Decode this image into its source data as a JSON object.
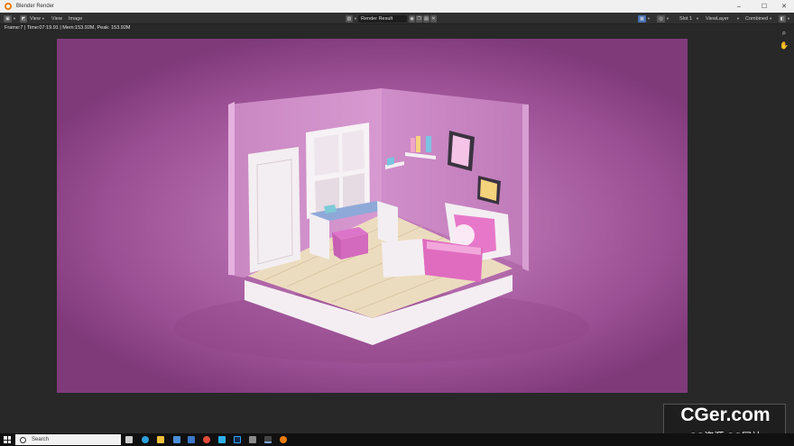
{
  "window": {
    "title": "Blender Render",
    "minimize": "–",
    "maximize": "☐",
    "close": "✕"
  },
  "header": {
    "menus": [
      "View",
      "View",
      "Image"
    ],
    "image_name": "Render Result",
    "slot": "Slot 1",
    "view_layer": "ViewLayer",
    "pass": "Combined"
  },
  "status": {
    "text": "Frame:7 | Time:07:19.91 | Mem:153.92M, Peak: 153.92M"
  },
  "taskbar": {
    "search_placeholder": "Search"
  },
  "watermark": {
    "brand": "CGer.com",
    "sub": "CG资源 CG网站"
  },
  "colors": {
    "accent": "#e87d0d",
    "render_bg": "#b26aab",
    "header_bg": "#303030"
  }
}
